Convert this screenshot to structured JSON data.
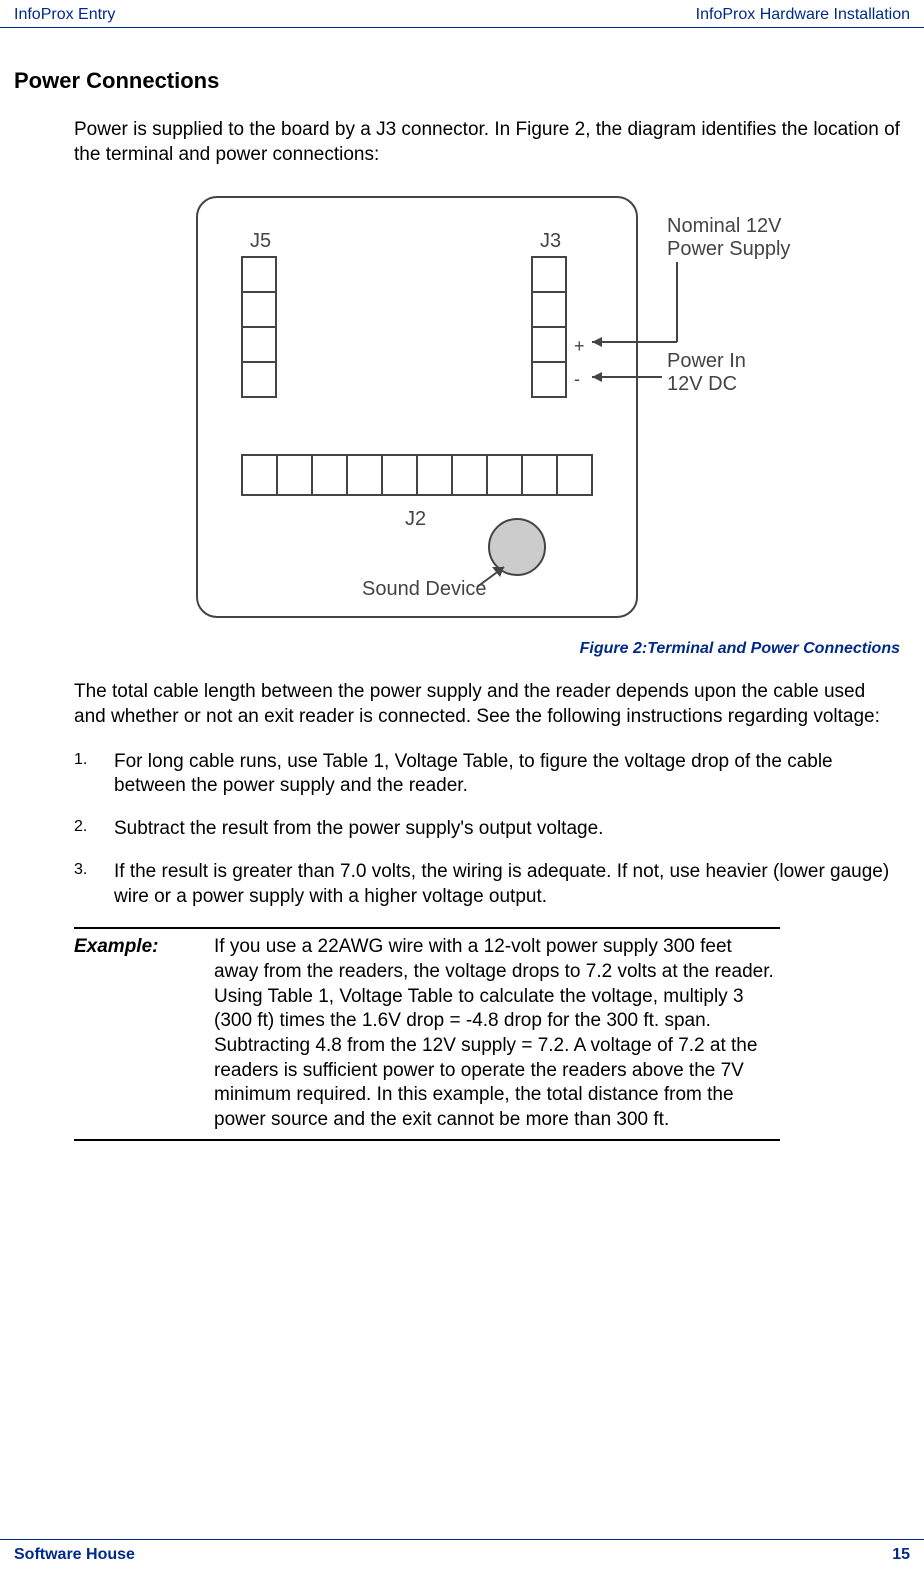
{
  "header": {
    "left": "InfoProx Entry",
    "right": "InfoProx Hardware Installation"
  },
  "section_title": "Power Connections",
  "intro": "Power is supplied to the board by a J3 connector. In Figure 2, the diagram identifies the location of the terminal and power connections:",
  "diagram": {
    "j5": "J5",
    "j3": "J3",
    "j2": "J2",
    "plus": "+",
    "minus": "-",
    "nominal_l1": "Nominal 12V",
    "nominal_l2": "Power Supply",
    "powerin_l1": "Power In",
    "powerin_l2": "12V DC",
    "sound": "Sound Device"
  },
  "caption": "Figure 2:Terminal and Power Connections",
  "para2": "The total cable length between the power supply and the reader depends upon the cable used and whether or not an exit reader is connected. See the following instructions regarding voltage:",
  "steps": [
    "For long cable runs, use Table 1, Voltage Table, to figure the voltage drop of the cable between the power supply and the reader.",
    "Subtract the result from the power supply's output voltage.",
    "If the result is greater than 7.0 volts, the wiring is adequate. If not, use heavier (lower gauge) wire or a power supply with a higher voltage output."
  ],
  "example": {
    "label": "Example:",
    "body": "If you use a 22AWG wire with a 12-volt power supply 300 feet away from the readers, the voltage drops to 7.2 volts at the reader.  Using Table 1, Voltage Table to calculate the voltage, multiply 3 (300 ft) times the 1.6V drop = -4.8 drop for the 300 ft. span.  Subtracting 4.8 from the 12V supply = 7.2. A voltage of 7.2 at the readers is sufficient power to operate the readers above the 7V minimum required. In this example, the total distance from the power source and the exit cannot be more than 300 ft."
  },
  "footer": {
    "left": "Software House",
    "right": "15"
  }
}
